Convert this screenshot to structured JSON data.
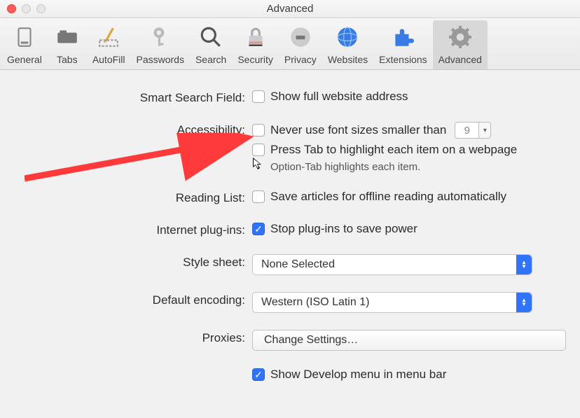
{
  "window": {
    "title": "Advanced"
  },
  "toolbar": {
    "items": [
      {
        "label": "General"
      },
      {
        "label": "Tabs"
      },
      {
        "label": "AutoFill"
      },
      {
        "label": "Passwords"
      },
      {
        "label": "Search"
      },
      {
        "label": "Security"
      },
      {
        "label": "Privacy"
      },
      {
        "label": "Websites"
      },
      {
        "label": "Extensions"
      },
      {
        "label": "Advanced"
      }
    ]
  },
  "sections": {
    "smart_search": {
      "label": "Smart Search Field:",
      "show_full_url": "Show full website address"
    },
    "accessibility": {
      "label": "Accessibility:",
      "never_smaller": "Never use font sizes smaller than",
      "min_font_value": "9",
      "press_tab": "Press Tab to highlight each item on a webpage",
      "press_tab_hint": "Option-Tab highlights each item."
    },
    "reading_list": {
      "label": "Reading List:",
      "save_offline": "Save articles for offline reading automatically"
    },
    "plugins": {
      "label": "Internet plug-ins:",
      "stop_plugins": "Stop plug-ins to save power"
    },
    "stylesheet": {
      "label": "Style sheet:",
      "value": "None Selected"
    },
    "encoding": {
      "label": "Default encoding:",
      "value": "Western (ISO Latin 1)"
    },
    "proxies": {
      "label": "Proxies:",
      "button": "Change Settings…"
    },
    "develop": {
      "show_develop": "Show Develop menu in menu bar"
    }
  }
}
